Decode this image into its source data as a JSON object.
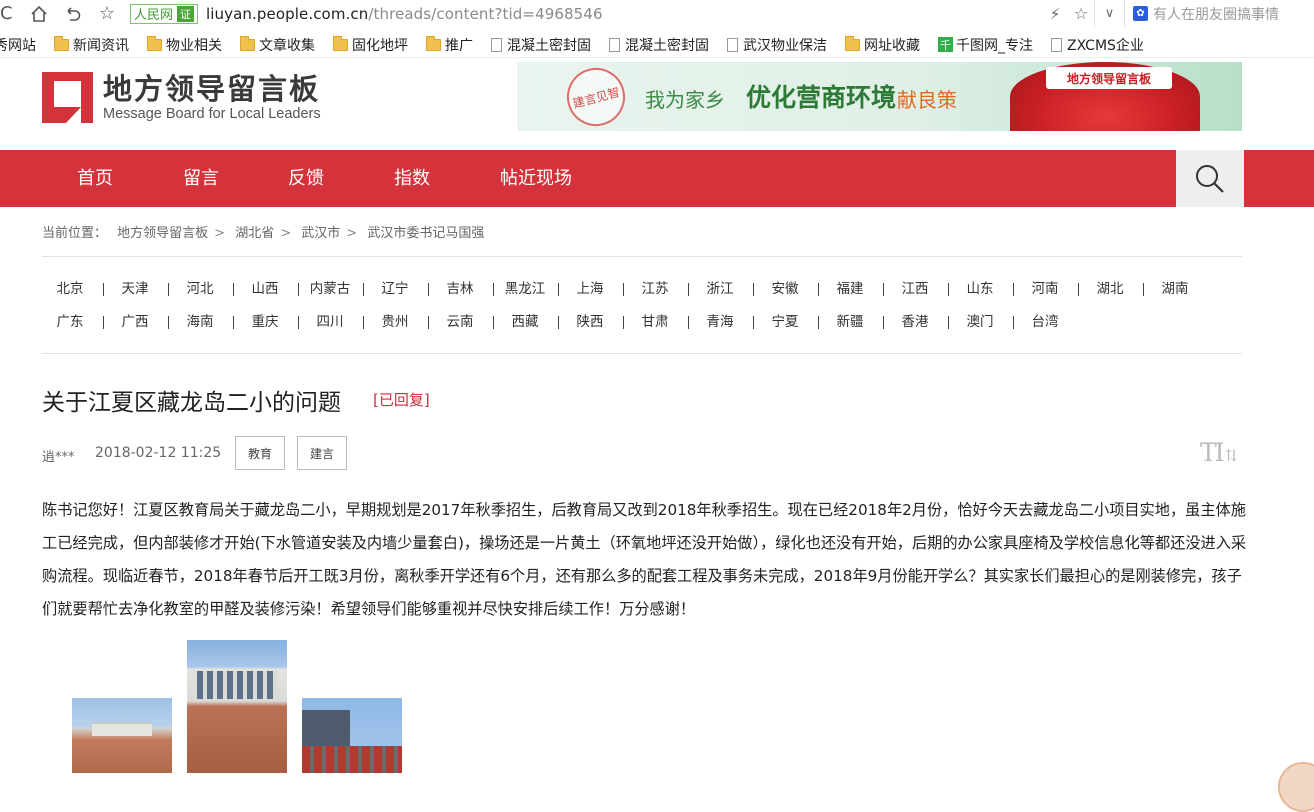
{
  "browser": {
    "site_badge": "人民网",
    "cert_badge": "证",
    "url_host": "liuyan.people.com.cn",
    "url_path": "/threads/content?tid=4968546",
    "hot_search": "有人在朋友圈搞事情",
    "bookmarks": [
      {
        "label": "秀网站",
        "icon": "none"
      },
      {
        "label": "新闻资讯",
        "icon": "folder"
      },
      {
        "label": "物业相关",
        "icon": "folder"
      },
      {
        "label": "文章收集",
        "icon": "folder"
      },
      {
        "label": "固化地坪",
        "icon": "folder"
      },
      {
        "label": "推广",
        "icon": "folder"
      },
      {
        "label": "混凝土密封固",
        "icon": "page"
      },
      {
        "label": "混凝土密封固",
        "icon": "page"
      },
      {
        "label": "武汉物业保洁",
        "icon": "page"
      },
      {
        "label": "网址收藏",
        "icon": "folder"
      },
      {
        "label": "千图网_专注",
        "icon": "qiantu"
      },
      {
        "label": "ZXCMS企业",
        "icon": "page"
      }
    ]
  },
  "site": {
    "logo_cn": "地方领导留言板",
    "logo_en": "Message Board for Local Leaders",
    "banner": {
      "stamp": "建言见智",
      "line1": "我为家乡",
      "line2": "优化营商环境",
      "line3": "献良策",
      "lamp_label": "地方领导留言板"
    },
    "nav": [
      "首页",
      "留言",
      "反馈",
      "指数",
      "帖近现场"
    ]
  },
  "breadcrumb": {
    "prefix": "当前位置：",
    "items": [
      "地方领导留言板",
      "湖北省",
      "武汉市",
      "武汉市委书记马国强"
    ]
  },
  "provinces_row1": [
    "北京",
    "天津",
    "河北",
    "山西",
    "内蒙古",
    "辽宁",
    "吉林",
    "黑龙江",
    "上海",
    "江苏",
    "浙江",
    "安徽",
    "福建",
    "江西",
    "山东",
    "河南",
    "湖北",
    "湖南"
  ],
  "provinces_row2": [
    "广东",
    "广西",
    "海南",
    "重庆",
    "四川",
    "贵州",
    "云南",
    "西藏",
    "陕西",
    "甘肃",
    "青海",
    "宁夏",
    "新疆",
    "香港",
    "澳门",
    "台湾"
  ],
  "article": {
    "title": "关于江夏区藏龙岛二小的问题",
    "status": "[已回复]",
    "author": "逍***",
    "datetime": "2018-02-12 11:25",
    "tags": [
      "教育",
      "建言"
    ],
    "font_toggle": "TI",
    "body": "陈书记您好！江夏区教育局关于藏龙岛二小，早期规划是2017年秋季招生，后教育局又改到2018年秋季招生。现在已经2018年2月份，恰好今天去藏龙岛二小项目实地，虽主体施工已经完成，但内部装修才开始(下水管道安装及内墙少量套白)，操场还是一片黄土（环氧地坪还没开始做），绿化也还没有开始，后期的办公家具座椅及学校信息化等都还没进入采购流程。现临近春节，2018年春节后开工既3月份，离秋季开学还有6个月，还有那么多的配套工程及事务未完成，2018年9月份能开学么？其实家长们最担心的是刚装修完，孩子们就要帮忙去净化教室的甲醛及装修污染！希望领导们能够重视并尽快安排后续工作！万分感谢！"
  },
  "colors": {
    "brand_red": "#d5333c",
    "status_red": "#c9303a"
  }
}
